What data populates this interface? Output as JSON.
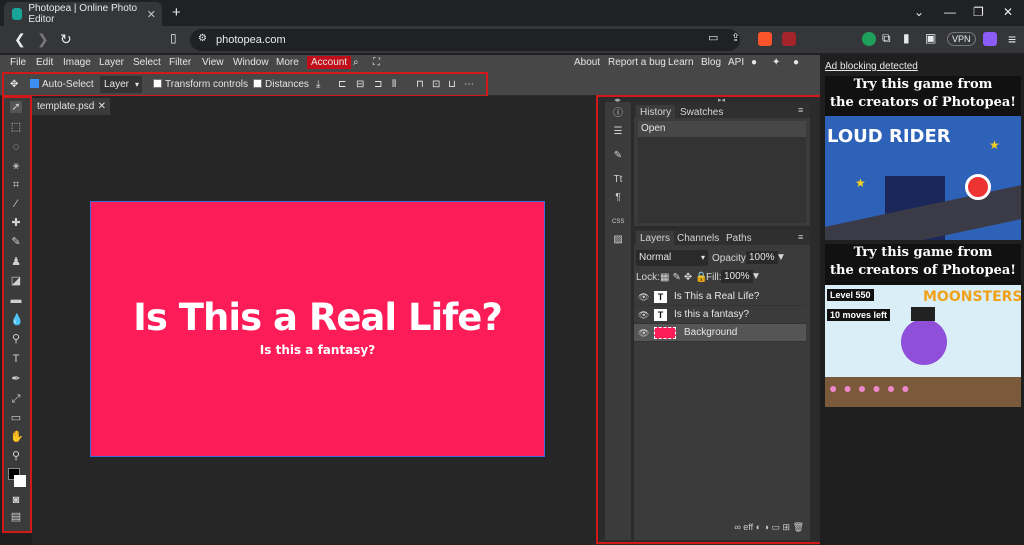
{
  "browser": {
    "tab_title": "Photopea | Online Photo Editor",
    "tab_close": "✕",
    "new_tab": "+",
    "url": "photopea.com",
    "vpn_label": "VPN",
    "window_min": "⌄",
    "window_minimize": "—",
    "window_restore": "❐",
    "window_close": "✕"
  },
  "menu": {
    "items": [
      "File",
      "Edit",
      "Image",
      "Layer",
      "Select",
      "Filter",
      "View",
      "Window",
      "More"
    ],
    "account": "Account",
    "right_items": [
      "About",
      "Report a bug",
      "Learn",
      "Blog",
      "API"
    ]
  },
  "options": {
    "auto_select_label": "Auto-Select",
    "auto_select_checked": true,
    "layer_select_value": "Layer",
    "transform_controls_label": "Transform controls",
    "distances_label": "Distances"
  },
  "document": {
    "tab_name": "template.psd",
    "tab_close": "✕",
    "headline": "Is This a Real Life?",
    "subheadline": "Is this a fantasy?",
    "canvas_color": "#fc1c57"
  },
  "history_panel": {
    "tabs": [
      "History",
      "Swatches"
    ],
    "entries": [
      "Open"
    ]
  },
  "layers_panel": {
    "tabs": [
      "Layers",
      "Channels",
      "Paths"
    ],
    "blend_mode": "Normal",
    "opacity_label": "Opacity:",
    "opacity_value": "100%",
    "lock_label": "Lock:",
    "fill_label": "Fill:",
    "fill_value": "100%",
    "layers": [
      {
        "name": "Is This a Real Life?",
        "kind": "T"
      },
      {
        "name": "Is this a fantasy?",
        "kind": "T"
      },
      {
        "name": "Background",
        "kind": "image"
      }
    ],
    "footer_icons": "∞ eff ◐ ◑ ▭ ⊞ 🗑"
  },
  "ads": {
    "blocking_link": "Ad blocking detected",
    "headline_1": "Try this game from",
    "headline_2": "the creators of Photopea!",
    "game1_title": "LOUD RIDER",
    "game2_title": "MOONSTERS",
    "game2_level": "Level 550",
    "game2_moves": "10 moves left"
  },
  "colors": {
    "accent_red": "#d01919",
    "account_bg": "#c00f1a",
    "checkbox_blue": "#3c8ef0"
  }
}
